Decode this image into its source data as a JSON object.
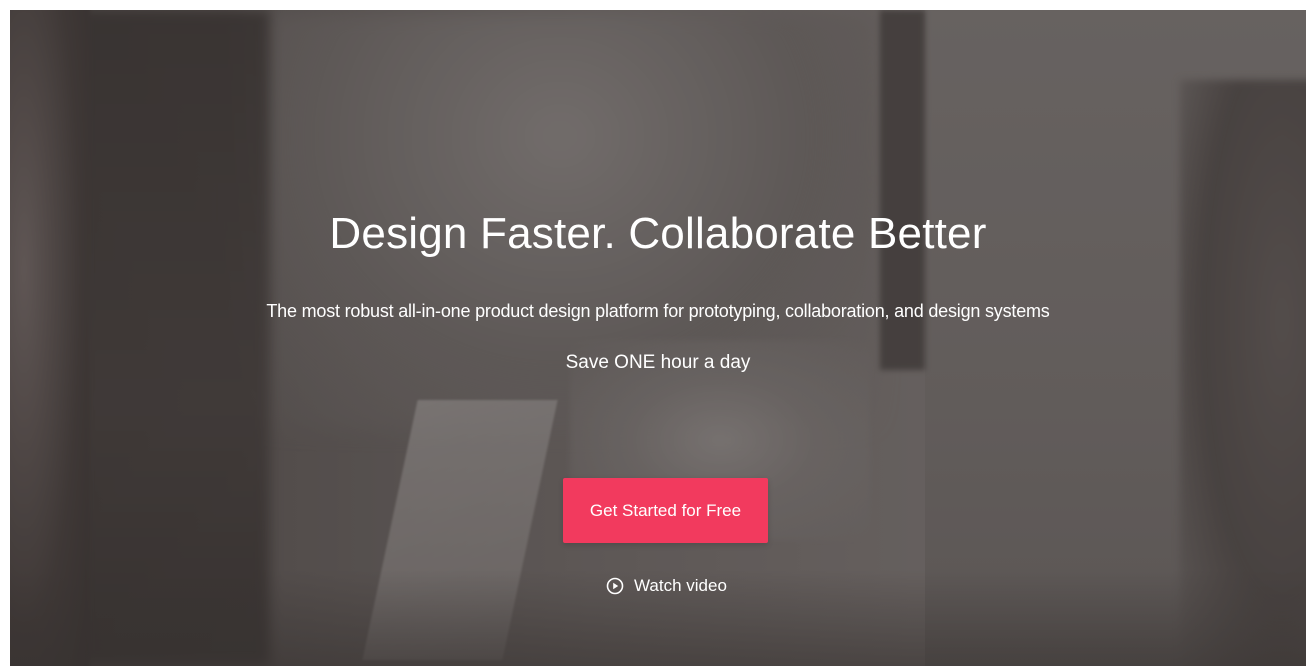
{
  "hero": {
    "headline": "Design Faster. Collaborate Better",
    "subtitle": "The most robust all-in-one product design platform for prototyping, collaboration, and design systems",
    "tagline": "Save ONE hour a day",
    "cta_label": "Get Started for Free",
    "watch_label": "Watch video",
    "watch_icon": "play-circle-icon"
  },
  "colors": {
    "cta_background": "#f23a5e",
    "text": "#ffffff"
  }
}
